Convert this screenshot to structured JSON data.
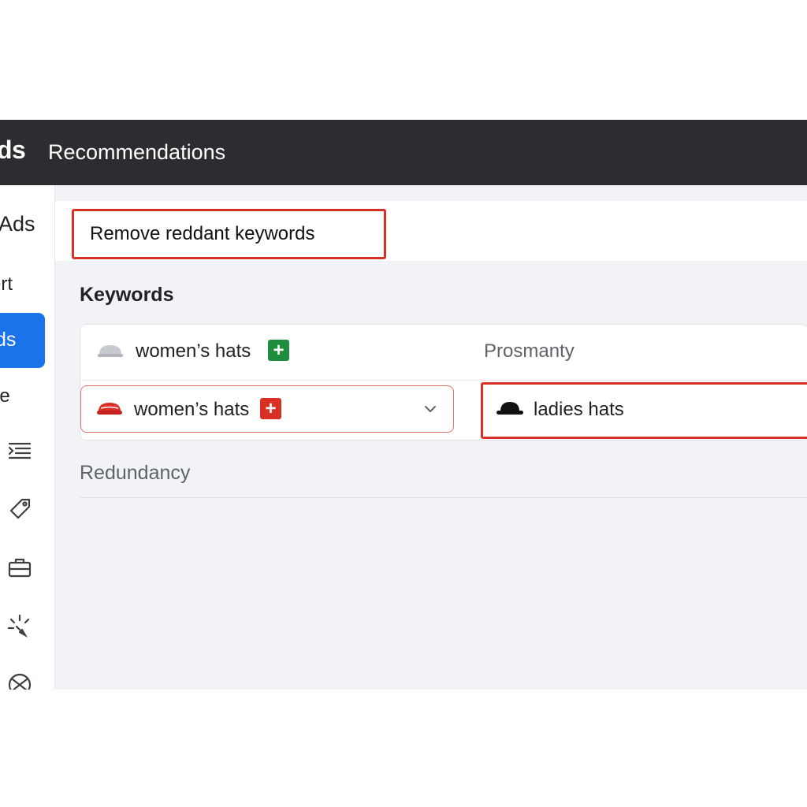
{
  "header": {
    "brand": "ds",
    "title": "Recommendations"
  },
  "sidebar": {
    "items": [
      {
        "label": "Ads"
      },
      {
        "label": "ert"
      },
      {
        "label": "ds",
        "active": true
      },
      {
        "label": "ge"
      }
    ],
    "icons": [
      "list-icon",
      "tag-icon",
      "briefcase-icon",
      "sparkle-icon",
      "tool-icon"
    ]
  },
  "recommendation": {
    "title": "Remove reddant keywords"
  },
  "keywords": {
    "section_title": "Keywords",
    "column_header": "Prosmanty",
    "rows": [
      {
        "keyword": "women’s hats",
        "badge": "+",
        "badge_color": "#1e8e3e"
      },
      {
        "keyword": "women’s hats",
        "badge": "+",
        "badge_color": "#d93025",
        "match": "ladies hats"
      }
    ]
  },
  "redundancy": {
    "label": "Redundancy"
  },
  "colors": {
    "header_bg": "#2b2d30",
    "accent_blue": "#1a73e8",
    "highlight_red": "#d93025",
    "add_green": "#1e8e3e",
    "page_bg": "#f1f3f6"
  }
}
